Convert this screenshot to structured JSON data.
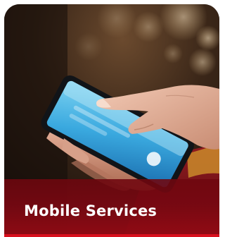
{
  "card": {
    "title": "Mobile Services",
    "image_subject": "hand-holding-smartphone-photo",
    "accent_color": "#c8101e"
  }
}
